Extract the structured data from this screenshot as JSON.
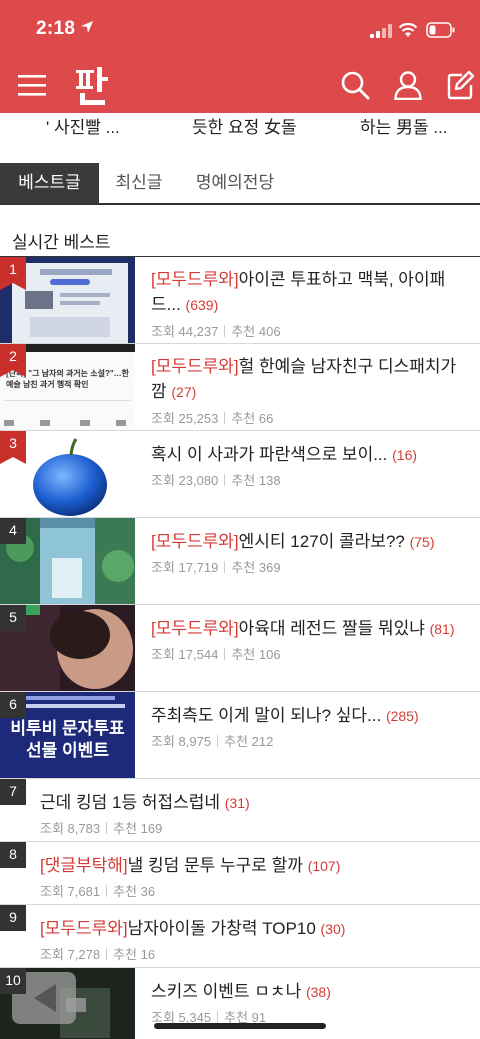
{
  "status": {
    "time": "2:18"
  },
  "app": {
    "logo_char": "판"
  },
  "strip": [
    "' 사진빨 ...",
    "듯한 요정 女돌",
    "하는 男돌 ..."
  ],
  "tabs": [
    "베스트글",
    "최신글",
    "명예의전당"
  ],
  "section_title": "실시간 베스트",
  "posts": [
    {
      "rank": "1",
      "tag": "[모두드루와]",
      "title": "아이콘 투표하고 맥북, 아이패드...",
      "comments": "(639)",
      "views_label": "조회",
      "views": "44,237",
      "rec_label": "추천",
      "rec": "406",
      "has_thumb": true
    },
    {
      "rank": "2",
      "tag": "[모두드루와]",
      "title": "헐 한예슬 남자친구 디스패치가 깜",
      "comments": "(27)",
      "views_label": "조회",
      "views": "25,253",
      "rec_label": "추천",
      "rec": "66",
      "has_thumb": true
    },
    {
      "rank": "3",
      "tag": "",
      "title": "혹시 이 사과가 파란색으로 보이...",
      "comments": "(16)",
      "views_label": "조회",
      "views": "23,080",
      "rec_label": "추천",
      "rec": "138",
      "has_thumb": true
    },
    {
      "rank": "4",
      "tag": "[모두드루와]",
      "title": "엔시티 127이 콜라보??",
      "comments": "(75)",
      "views_label": "조회",
      "views": "17,719",
      "rec_label": "추천",
      "rec": "369",
      "has_thumb": true
    },
    {
      "rank": "5",
      "tag": "[모두드루와]",
      "title": "아육대 레전드 짤들 뭐있냐",
      "comments": "(81)",
      "views_label": "조회",
      "views": "17,544",
      "rec_label": "추천",
      "rec": "106",
      "has_thumb": true
    },
    {
      "rank": "6",
      "tag": "",
      "title": "주최측도 이게 말이 되나? 싶다...",
      "comments": "(285)",
      "views_label": "조회",
      "views": "8,975",
      "rec_label": "추천",
      "rec": "212",
      "has_thumb": true
    },
    {
      "rank": "7",
      "tag": "",
      "title": "근데 킹덤 1등 허접스럽네",
      "comments": "(31)",
      "views_label": "조회",
      "views": "8,783",
      "rec_label": "추천",
      "rec": "169",
      "has_thumb": false
    },
    {
      "rank": "8",
      "tag": "[댓글부탁해]",
      "title": "낼 킹덤 문투 누구로 할까",
      "comments": "(107)",
      "views_label": "조회",
      "views": "7,681",
      "rec_label": "추천",
      "rec": "36",
      "has_thumb": false
    },
    {
      "rank": "9",
      "tag": "[모두드루와]",
      "title": "남자아이돌 가창력 TOP10",
      "comments": "(30)",
      "views_label": "조회",
      "views": "7,278",
      "rec_label": "추천",
      "rec": "16",
      "has_thumb": false
    },
    {
      "rank": "10",
      "tag": "",
      "title": "스키즈 이벤트 ㅁㅊ나",
      "comments": "(38)",
      "views_label": "조회",
      "views": "5,345",
      "rec_label": "추천",
      "rec": "91",
      "has_thumb": true
    }
  ],
  "thumb_text": {
    "p2_line1": "[단독] \"그 남자의 과거는 소설?\"…한",
    "p2_line2": "예슬 남친 과거 행적 확인",
    "p6_line1": "비투비 문자투표",
    "p6_line2": "선물 이벤트"
  },
  "colors": {
    "header": "#de4a4c",
    "accent": "#d53b35"
  }
}
